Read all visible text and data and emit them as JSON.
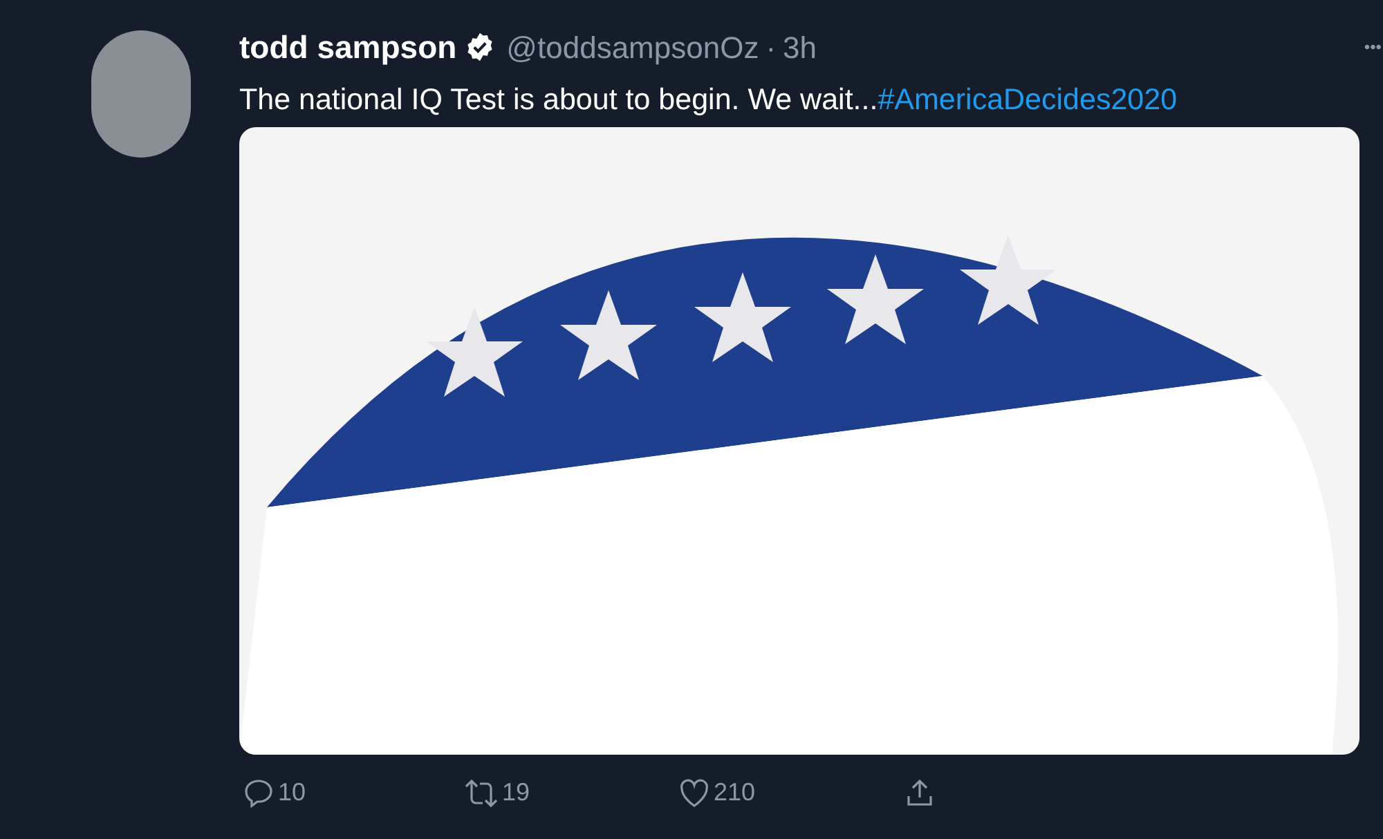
{
  "tweet": {
    "name": "todd sampson",
    "verified": true,
    "handle": "@toddsampsonOz",
    "separator": "·",
    "time": "3h",
    "more": "•••",
    "text": "The national IQ Test is about to begin. We wait...",
    "hashtag": "#AmericaDecides2020"
  },
  "actions": [
    {
      "kind": "reply",
      "count": "10"
    },
    {
      "kind": "retweet",
      "count": "19"
    },
    {
      "kind": "like",
      "count": "210"
    },
    {
      "kind": "share"
    }
  ]
}
